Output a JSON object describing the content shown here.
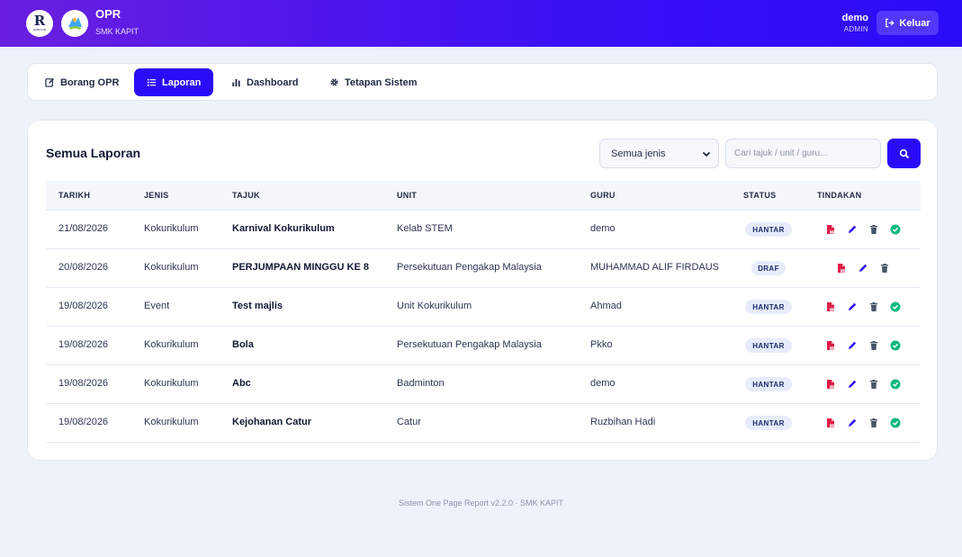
{
  "header": {
    "logo1_text": "R",
    "logo1_small": "RUBICON",
    "title": "OPR",
    "subtitle": "SMK KAPIT",
    "user_name": "demo",
    "user_role": "ADMIN",
    "logout_label": "Keluar"
  },
  "nav": {
    "tabs": [
      {
        "label": "Borang OPR",
        "icon": "edit-icon"
      },
      {
        "label": "Laporan",
        "icon": "list-icon",
        "active": true
      },
      {
        "label": "Dashboard",
        "icon": "bar-chart-icon"
      },
      {
        "label": "Tetapan Sistem",
        "icon": "gear-icon"
      }
    ]
  },
  "reports": {
    "title": "Semua Laporan",
    "filter_value": "Semua jenis",
    "search_placeholder": "Cari tajuk / unit / guru...",
    "columns": [
      "TARIKH",
      "JENIS",
      "TAJUK",
      "UNIT",
      "GURU",
      "STATUS",
      "TINDAKAN"
    ],
    "rows": [
      {
        "date": "21/08/2026",
        "type": "Kokurikulum",
        "title": "Karnival Kokurikulum",
        "unit": "Kelab STEM",
        "teacher": "demo",
        "status": "HANTAR"
      },
      {
        "date": "20/08/2026",
        "type": "Kokurikulum",
        "title": "PERJUMPAAN MINGGU KE 8",
        "unit": "Persekutuan Pengakap Malaysia",
        "teacher": "MUHAMMAD ALIF FIRDAUS",
        "status": "DRAF"
      },
      {
        "date": "19/08/2026",
        "type": "Event",
        "title": "Test majlis",
        "unit": "Unit Kokurikulum",
        "teacher": "Ahmad",
        "status": "HANTAR"
      },
      {
        "date": "19/08/2026",
        "type": "Kokurikulum",
        "title": "Bola",
        "unit": "Persekutuan Pengakap Malaysia",
        "teacher": "Pkko",
        "status": "HANTAR"
      },
      {
        "date": "19/08/2026",
        "type": "Kokurikulum",
        "title": "Abc",
        "unit": "Badminton",
        "teacher": "demo",
        "status": "HANTAR"
      },
      {
        "date": "19/08/2026",
        "type": "Kokurikulum",
        "title": "Kejohanan Catur",
        "unit": "Catur",
        "teacher": "Ruzbihan Hadi",
        "status": "HANTAR"
      }
    ]
  },
  "footer": {
    "text": "Sistem One Page Report v2.2.0 · SMK KAPIT"
  },
  "colors": {
    "primary": "#2a0cf8",
    "pdf": "#e11d48",
    "edit": "#2a0cf8",
    "delete": "#475569",
    "approve": "#10b981"
  }
}
